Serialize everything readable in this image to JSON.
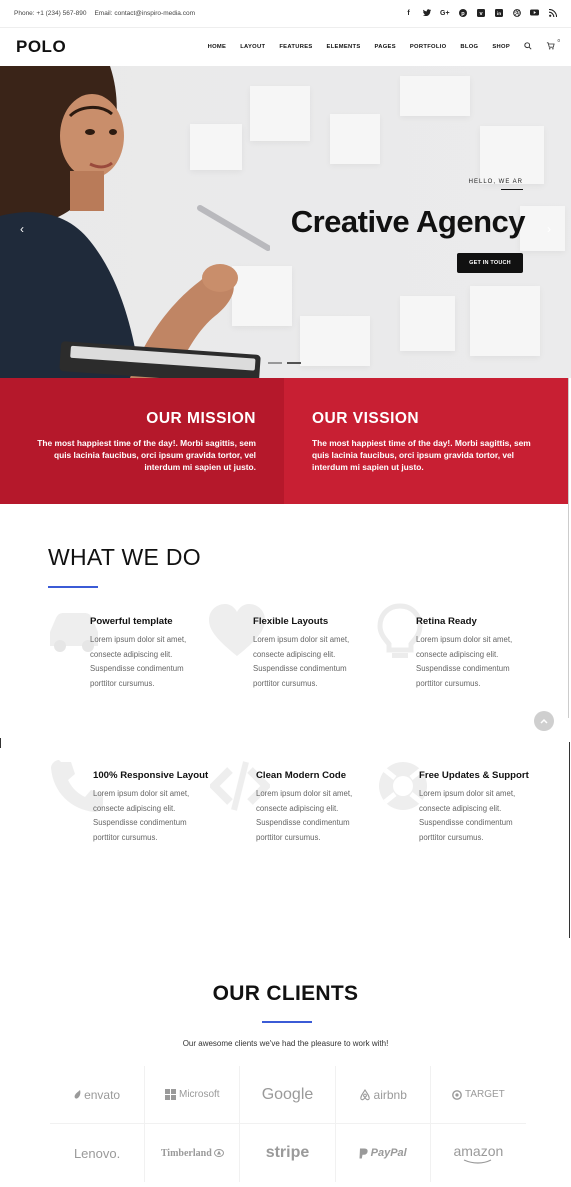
{
  "topbar": {
    "phone": "Phone: +1 (234) 567-890",
    "email": "Email: contact@inspiro-media.com",
    "socials": [
      "f",
      "t",
      "G+",
      "p",
      "v",
      "in",
      "d",
      "yt",
      "rss"
    ]
  },
  "header": {
    "logo": "POLO",
    "nav": [
      "HOME",
      "LAYOUT",
      "FEATURES",
      "ELEMENTS",
      "PAGES",
      "PORTFOLIO",
      "BLOG",
      "SHOP"
    ],
    "cart_count": "0"
  },
  "hero": {
    "eyebrow": "HELLO, WE AR",
    "title": "Creative Agency",
    "cta": "GET IN TOUCH"
  },
  "mission": {
    "title": "OUR MISSION",
    "text": "The most happiest time of the day!. Morbi sagittis, sem quis lacinia faucibus, orci ipsum gravida tortor, vel interdum mi sapien ut justo."
  },
  "vision": {
    "title": "OUR VISSION",
    "text": "The most happiest time of the day!. Morbi sagittis, sem quis lacinia faucibus, orci ipsum gravida tortor, vel interdum mi sapien ut justo."
  },
  "what_we_do": {
    "title": "WHAT WE DO",
    "features": [
      {
        "title": "Powerful template",
        "text": "Lorem ipsum dolor sit amet, consecte adipiscing elit. Suspendisse condimentum porttitor cursumus.",
        "icon": "car-icon"
      },
      {
        "title": "Flexible Layouts",
        "text": "Lorem ipsum dolor sit amet, consecte adipiscing elit. Suspendisse condimentum porttitor cursumus.",
        "icon": "heart-icon"
      },
      {
        "title": "Retina Ready",
        "text": "Lorem ipsum dolor sit amet, consecte adipiscing elit. Suspendisse condimentum porttitor cursumus.",
        "icon": "lightbulb-icon"
      },
      {
        "title": "100% Responsive Layout",
        "text": "Lorem ipsum dolor sit amet, consecte adipiscing elit. Suspendisse condimentum porttitor cursumus.",
        "icon": "phone-icon"
      },
      {
        "title": "Clean Modern Code",
        "text": "Lorem ipsum dolor sit amet, consecte adipiscing elit. Suspendisse condimentum porttitor cursumus.",
        "icon": "code-icon"
      },
      {
        "title": "Free Updates & Support",
        "text": "Lorem ipsum dolor sit amet, consecte adipiscing elit. Suspendisse condimentum porttitor cursumus.",
        "icon": "lifebuoy-icon"
      }
    ]
  },
  "clients": {
    "title": "OUR CLIENTS",
    "subtitle": "Our awesome clients we've had the pleasure to work with!",
    "logos": [
      "envato",
      "Microsoft",
      "Google",
      "airbnb",
      "TARGET",
      "Lenovo.",
      "Timberland",
      "stripe",
      "PayPal",
      "amazon"
    ]
  },
  "colors": {
    "mission_red": "#b5182b",
    "vision_red": "#c81f33",
    "accent_blue": "#3b5bd6"
  }
}
